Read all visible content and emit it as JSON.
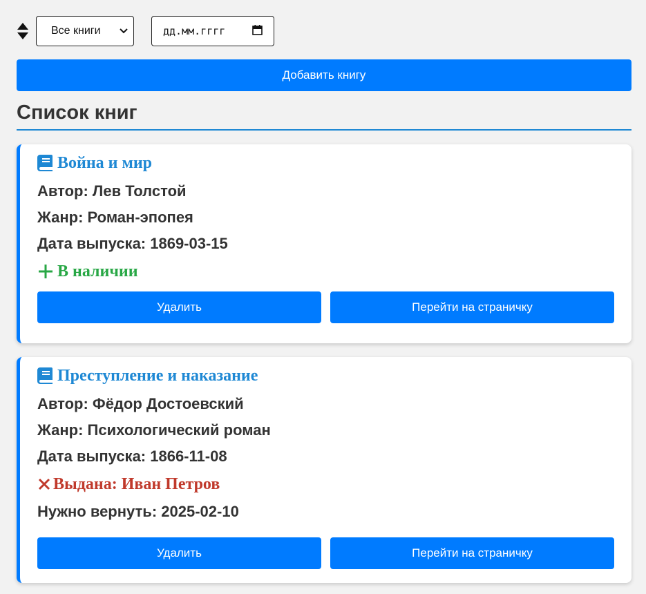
{
  "toolbar": {
    "filter_selected": "Все книги",
    "date_placeholder": "дд.мм.гггг",
    "add_button": "Добавить книгу"
  },
  "list_title": "Список книг",
  "books": [
    {
      "title": "Война и мир",
      "author": "Автор: Лев Толстой",
      "genre": "Жанр: Роман-эпопея",
      "release": "Дата выпуска: 1869-03-15",
      "status": "В наличии",
      "status_type": "available",
      "delete_label": "Удалить",
      "open_label": "Перейти на страничку"
    },
    {
      "title": "Преступление и наказание",
      "author": "Автор: Фёдор Достоевский",
      "genre": "Жанр: Психологический роман",
      "release": "Дата выпуска: 1866-11-08",
      "status": "Выдана: Иван Петров",
      "status_type": "issued",
      "due": "Нужно вернуть: 2025-02-10",
      "delete_label": "Удалить",
      "open_label": "Перейти на страничку"
    }
  ],
  "icons": {
    "sort": "sort-icon",
    "dropdown": "chevron-down-icon",
    "calendar": "calendar-icon",
    "book": "book-icon",
    "available": "plus-icon",
    "issued": "cross-icon"
  },
  "colors": {
    "primary": "#007bff",
    "title": "#1e88d4",
    "available": "#28a745",
    "issued": "#c0392b"
  }
}
